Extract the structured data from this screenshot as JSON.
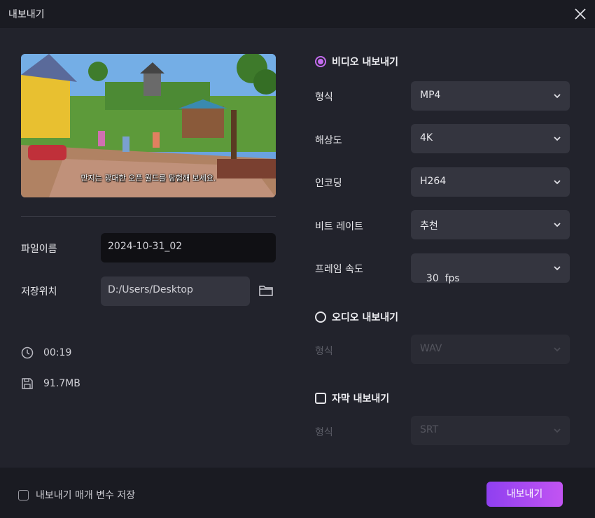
{
  "window": {
    "title": "내보내기"
  },
  "preview": {
    "subtitle": "만지는 광대한 오픈 월드를 탐험해 보세요."
  },
  "file": {
    "name_label": "파일이름",
    "name_value": "2024-10-31_02",
    "location_label": "저장위치",
    "location_value": "D:/Users/Desktop"
  },
  "info": {
    "duration": "00:19",
    "size": "91.7MB"
  },
  "video_export": {
    "label": "비디오 내보내기",
    "selected": true,
    "fields": [
      {
        "label": "형식",
        "value": "MP4"
      },
      {
        "label": "해상도",
        "value": "4K"
      },
      {
        "label": "인코딩",
        "value": "H264"
      },
      {
        "label": "비트 레이트",
        "value": "추천"
      },
      {
        "label": "프레임 속도",
        "value": "30  fps"
      }
    ]
  },
  "audio_export": {
    "label": "오디오 내보내기",
    "selected": false,
    "format_label": "형식",
    "format_value": "WAV"
  },
  "subtitle_export": {
    "label": "자막 내보내기",
    "checked": false,
    "format_label": "형식",
    "format_value": "SRT"
  },
  "footer": {
    "save_params_label": "내보내기 매개 변수 저장",
    "export_label": "내보내기"
  },
  "colors": {
    "accent": "#c56cf0",
    "button_start": "#8f40f0",
    "button_end": "#c254f2"
  }
}
